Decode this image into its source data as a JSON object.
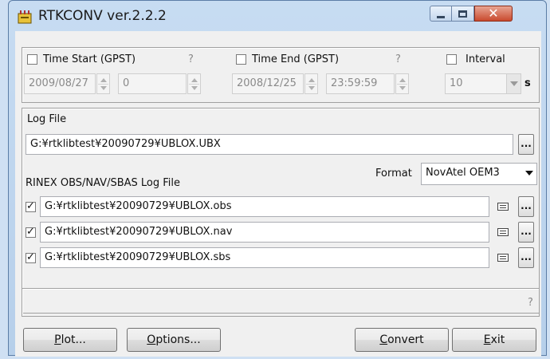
{
  "window": {
    "title": "RTKCONV ver.2.2.2"
  },
  "time_panel": {
    "time_start": {
      "label": "Time Start (GPST)",
      "help": "?",
      "checked": false,
      "date": "2009/08/27",
      "time": "0"
    },
    "time_end": {
      "label": "Time End (GPST)",
      "help": "?",
      "checked": false,
      "date": "2008/12/25",
      "time": "23:59:59"
    },
    "interval": {
      "label": "Interval",
      "checked": false,
      "value": "10",
      "unit": "s"
    }
  },
  "log_panel": {
    "log_file_label": "Log File",
    "log_file_path": "G:¥rtklibtest¥20090729¥UBLOX.UBX",
    "browse_label": "...",
    "format_label": "Format",
    "format_value": "NovAtel OEM3",
    "rinex_label": "RINEX OBS/NAV/SBAS Log File",
    "outputs": [
      {
        "checked": true,
        "path": "G:¥rtklibtest¥20090729¥UBLOX.obs"
      },
      {
        "checked": true,
        "path": "G:¥rtklibtest¥20090729¥UBLOX.nav"
      },
      {
        "checked": true,
        "path": "G:¥rtklibtest¥20090729¥UBLOX.sbs"
      }
    ]
  },
  "status": {
    "help": "?"
  },
  "buttons": {
    "plot": {
      "accel": "P",
      "rest": "lot..."
    },
    "options": {
      "accel": "O",
      "rest": "ptions..."
    },
    "convert": {
      "accel": "C",
      "rest": "onvert"
    },
    "exit": {
      "accel": "E",
      "rest": "xit"
    }
  },
  "colors": {
    "title_bar": "#c7dcf2",
    "close_button": "#c94a2e",
    "client_bg": "#f0f0f0"
  }
}
